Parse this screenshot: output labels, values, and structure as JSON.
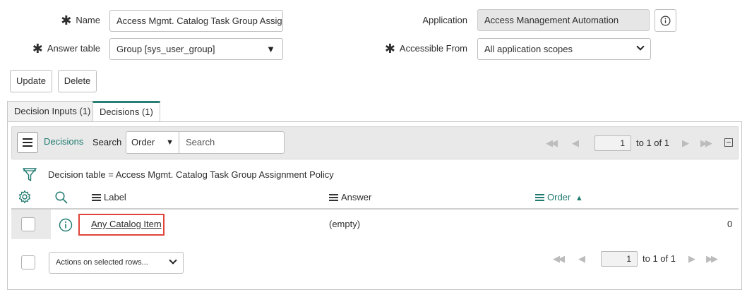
{
  "form": {
    "name_label": "Name",
    "name_value": "Access Mgmt. Catalog Task Group Assignm",
    "answer_table_label": "Answer table",
    "answer_table_value": "Group [sys_user_group]",
    "application_label": "Application",
    "application_value": "Access Management Automation",
    "accessible_from_label": "Accessible From",
    "accessible_from_value": "All application scopes",
    "required_mark": "✱"
  },
  "buttons": {
    "update": "Update",
    "delete": "Delete"
  },
  "tabs": [
    {
      "label": "Decision Inputs (1)",
      "active": false
    },
    {
      "label": "Decisions (1)",
      "active": true
    }
  ],
  "list": {
    "title": "Decisions",
    "search_label": "Search",
    "search_field": "Order",
    "search_placeholder": "Search",
    "page_value": "1",
    "page_range": "to 1 of 1",
    "filter_text": "Decision table = Access Mgmt. Catalog Task Group Assignment Policy",
    "columns": [
      "Label",
      "Answer",
      "Order"
    ],
    "sort_indicator": "▲",
    "rows": [
      {
        "label": "Any Catalog Item",
        "answer": "(empty)",
        "order": "0"
      }
    ],
    "actions_select": "Actions on selected rows...",
    "bottom_page_value": "1",
    "bottom_page_range": "to 1 of 1"
  },
  "colors": {
    "accent": "#1f7a70",
    "highlight_box": "#e0443a"
  }
}
